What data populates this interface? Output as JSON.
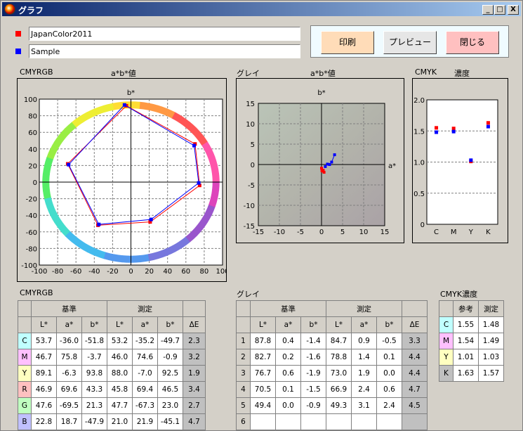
{
  "window": {
    "title": "グラフ",
    "min_symbol": "_",
    "max_symbol": "□",
    "close_symbol": "X"
  },
  "legend": [
    {
      "label": "JapanColor2011",
      "color": "#ff0000"
    },
    {
      "label": "Sample",
      "color": "#0000ff"
    }
  ],
  "buttons": {
    "print": "印刷",
    "preview": "プレビュー",
    "close": "閉じる"
  },
  "panels": {
    "cmyrgb": {
      "title_left": "CMYRGB",
      "title_center": "a*b*値"
    },
    "gray": {
      "title_left": "グレイ",
      "title_center": "a*b*値"
    },
    "cmyk": {
      "title_left": "CMYK",
      "title_center": "濃度"
    }
  },
  "chart_data": [
    {
      "type": "scatter",
      "name": "cmyrgb_ab",
      "xlabel": "a*",
      "ylabel": "b*",
      "xlim": [
        -100,
        100
      ],
      "ylim": [
        -100,
        100
      ],
      "xticks": [
        -100,
        -80,
        -60,
        -40,
        -20,
        0,
        20,
        40,
        60,
        80,
        100
      ],
      "yticks": [
        -100,
        -80,
        -60,
        -40,
        -20,
        0,
        20,
        40,
        60,
        80,
        100
      ],
      "grid": true,
      "series": [
        {
          "name": "JapanColor2011",
          "color": "#ff0000",
          "points": [
            [
              -5,
              92
            ],
            [
              70,
              46
            ],
            [
              75,
              -4
            ],
            [
              21,
              -48
            ],
            [
              -36,
              -52
            ],
            [
              -69,
              22
            ]
          ]
        },
        {
          "name": "Sample",
          "color": "#0000ff",
          "points": [
            [
              -7,
              93
            ],
            [
              69,
              44
            ],
            [
              74,
              -1
            ],
            [
              22,
              -45
            ],
            [
              -35,
              -51
            ],
            [
              -68,
              21
            ]
          ]
        }
      ]
    },
    {
      "type": "scatter",
      "name": "gray_ab",
      "xlabel": "a*",
      "ylabel": "b*",
      "xlim": [
        -15,
        15
      ],
      "ylim": [
        -15,
        15
      ],
      "xticks": [
        -15,
        -10,
        -5,
        0,
        5,
        10,
        15
      ],
      "yticks": [
        -15,
        -10,
        -5,
        0,
        5,
        10,
        15
      ],
      "grid": true,
      "series": [
        {
          "name": "JapanColor2011",
          "color": "#ff0000",
          "points": [
            [
              0.4,
              -1.4
            ],
            [
              0.2,
              -1.6
            ],
            [
              0.6,
              -1.9
            ],
            [
              0.1,
              -1.5
            ],
            [
              0.0,
              -0.9
            ]
          ]
        },
        {
          "name": "Sample",
          "color": "#0000ff",
          "points": [
            [
              0.9,
              -0.5
            ],
            [
              1.4,
              0.1
            ],
            [
              1.9,
              0.0
            ],
            [
              2.4,
              0.6
            ],
            [
              3.1,
              2.4
            ]
          ]
        }
      ]
    },
    {
      "type": "scatter",
      "name": "cmyk_density",
      "categories": [
        "C",
        "M",
        "Y",
        "K"
      ],
      "ylim": [
        0,
        2.0
      ],
      "yticks": [
        0,
        0.5,
        1.0,
        1.5,
        2.0
      ],
      "ytick_labels": [
        "0",
        "0.5",
        "1.0",
        "1.5",
        "2.0"
      ],
      "grid": true,
      "series": [
        {
          "name": "JapanColor2011",
          "color": "#ff0000",
          "values": [
            1.55,
            1.54,
            1.01,
            1.63
          ]
        },
        {
          "name": "Sample",
          "color": "#0000ff",
          "values": [
            1.48,
            1.49,
            1.03,
            1.57
          ]
        }
      ]
    }
  ],
  "cmyrgb_table": {
    "caption": "CMYRGB",
    "group_std": "基準",
    "group_meas": "測定",
    "cols": [
      "L*",
      "a*",
      "b*",
      "L*",
      "a*",
      "b*",
      "ΔE"
    ],
    "rows": [
      {
        "label": "C",
        "color": "#c0ffff",
        "values": [
          "53.7",
          "-36.0",
          "-51.8",
          "53.2",
          "-35.2",
          "-49.7",
          "2.3"
        ]
      },
      {
        "label": "M",
        "color": "#ffc0ff",
        "values": [
          "46.7",
          "75.8",
          "-3.7",
          "46.0",
          "74.6",
          "-0.9",
          "3.2"
        ]
      },
      {
        "label": "Y",
        "color": "#ffffc0",
        "values": [
          "89.1",
          "-6.3",
          "93.8",
          "88.0",
          "-7.0",
          "92.5",
          "1.9"
        ]
      },
      {
        "label": "R",
        "color": "#ffc0c0",
        "values": [
          "46.9",
          "69.6",
          "43.3",
          "45.8",
          "69.4",
          "46.5",
          "3.4"
        ]
      },
      {
        "label": "G",
        "color": "#c0ffc0",
        "values": [
          "47.6",
          "-69.5",
          "21.3",
          "47.7",
          "-67.3",
          "23.0",
          "2.7"
        ]
      },
      {
        "label": "B",
        "color": "#c0c0ff",
        "values": [
          "22.8",
          "18.7",
          "-47.9",
          "21.0",
          "21.9",
          "-45.1",
          "4.7"
        ]
      }
    ]
  },
  "gray_table": {
    "caption": "グレイ",
    "group_std": "基準",
    "group_meas": "測定",
    "cols": [
      "L*",
      "a*",
      "b*",
      "L*",
      "a*",
      "b*",
      "ΔE"
    ],
    "rows": [
      {
        "label": "1",
        "values": [
          "87.8",
          "0.4",
          "-1.4",
          "84.7",
          "0.9",
          "-0.5",
          "3.3"
        ]
      },
      {
        "label": "2",
        "values": [
          "82.7",
          "0.2",
          "-1.6",
          "78.8",
          "1.4",
          "0.1",
          "4.4"
        ]
      },
      {
        "label": "3",
        "values": [
          "76.7",
          "0.6",
          "-1.9",
          "73.0",
          "1.9",
          "0.0",
          "4.4"
        ]
      },
      {
        "label": "4",
        "values": [
          "70.5",
          "0.1",
          "-1.5",
          "66.9",
          "2.4",
          "0.6",
          "4.7"
        ]
      },
      {
        "label": "5",
        "values": [
          "49.4",
          "0.0",
          "-0.9",
          "49.3",
          "3.1",
          "2.4",
          "4.5"
        ]
      },
      {
        "label": "6",
        "values": [
          "",
          "",
          "",
          "",
          "",
          "",
          ""
        ]
      }
    ]
  },
  "cmyk_table": {
    "caption": "CMYK濃度",
    "cols": [
      "参考",
      "測定"
    ],
    "rows": [
      {
        "label": "C",
        "color": "#c0ffff",
        "values": [
          "1.55",
          "1.48"
        ]
      },
      {
        "label": "M",
        "color": "#ffc0ff",
        "values": [
          "1.54",
          "1.49"
        ]
      },
      {
        "label": "Y",
        "color": "#ffffc0",
        "values": [
          "1.01",
          "1.03"
        ]
      },
      {
        "label": "K",
        "color": "#c0c0c0",
        "values": [
          "1.63",
          "1.57"
        ]
      }
    ]
  }
}
